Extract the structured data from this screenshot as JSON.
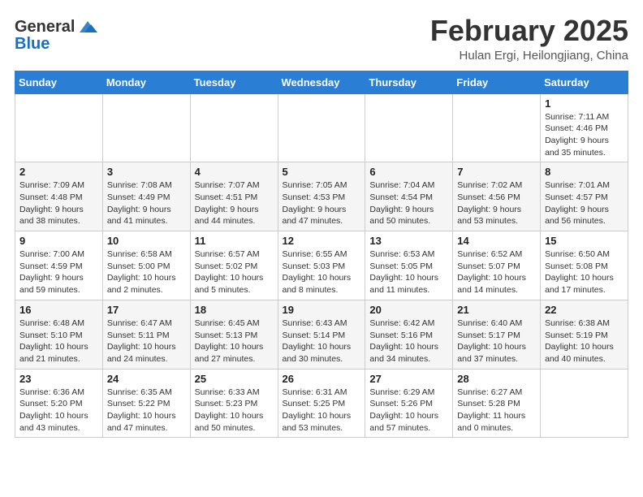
{
  "header": {
    "logo_general": "General",
    "logo_blue": "Blue",
    "month_title": "February 2025",
    "location": "Hulan Ergi, Heilongjiang, China"
  },
  "weekdays": [
    "Sunday",
    "Monday",
    "Tuesday",
    "Wednesday",
    "Thursday",
    "Friday",
    "Saturday"
  ],
  "weeks": [
    [
      {
        "day": "",
        "info": ""
      },
      {
        "day": "",
        "info": ""
      },
      {
        "day": "",
        "info": ""
      },
      {
        "day": "",
        "info": ""
      },
      {
        "day": "",
        "info": ""
      },
      {
        "day": "",
        "info": ""
      },
      {
        "day": "1",
        "info": "Sunrise: 7:11 AM\nSunset: 4:46 PM\nDaylight: 9 hours and 35 minutes."
      }
    ],
    [
      {
        "day": "2",
        "info": "Sunrise: 7:09 AM\nSunset: 4:48 PM\nDaylight: 9 hours and 38 minutes."
      },
      {
        "day": "3",
        "info": "Sunrise: 7:08 AM\nSunset: 4:49 PM\nDaylight: 9 hours and 41 minutes."
      },
      {
        "day": "4",
        "info": "Sunrise: 7:07 AM\nSunset: 4:51 PM\nDaylight: 9 hours and 44 minutes."
      },
      {
        "day": "5",
        "info": "Sunrise: 7:05 AM\nSunset: 4:53 PM\nDaylight: 9 hours and 47 minutes."
      },
      {
        "day": "6",
        "info": "Sunrise: 7:04 AM\nSunset: 4:54 PM\nDaylight: 9 hours and 50 minutes."
      },
      {
        "day": "7",
        "info": "Sunrise: 7:02 AM\nSunset: 4:56 PM\nDaylight: 9 hours and 53 minutes."
      },
      {
        "day": "8",
        "info": "Sunrise: 7:01 AM\nSunset: 4:57 PM\nDaylight: 9 hours and 56 minutes."
      }
    ],
    [
      {
        "day": "9",
        "info": "Sunrise: 7:00 AM\nSunset: 4:59 PM\nDaylight: 9 hours and 59 minutes."
      },
      {
        "day": "10",
        "info": "Sunrise: 6:58 AM\nSunset: 5:00 PM\nDaylight: 10 hours and 2 minutes."
      },
      {
        "day": "11",
        "info": "Sunrise: 6:57 AM\nSunset: 5:02 PM\nDaylight: 10 hours and 5 minutes."
      },
      {
        "day": "12",
        "info": "Sunrise: 6:55 AM\nSunset: 5:03 PM\nDaylight: 10 hours and 8 minutes."
      },
      {
        "day": "13",
        "info": "Sunrise: 6:53 AM\nSunset: 5:05 PM\nDaylight: 10 hours and 11 minutes."
      },
      {
        "day": "14",
        "info": "Sunrise: 6:52 AM\nSunset: 5:07 PM\nDaylight: 10 hours and 14 minutes."
      },
      {
        "day": "15",
        "info": "Sunrise: 6:50 AM\nSunset: 5:08 PM\nDaylight: 10 hours and 17 minutes."
      }
    ],
    [
      {
        "day": "16",
        "info": "Sunrise: 6:48 AM\nSunset: 5:10 PM\nDaylight: 10 hours and 21 minutes."
      },
      {
        "day": "17",
        "info": "Sunrise: 6:47 AM\nSunset: 5:11 PM\nDaylight: 10 hours and 24 minutes."
      },
      {
        "day": "18",
        "info": "Sunrise: 6:45 AM\nSunset: 5:13 PM\nDaylight: 10 hours and 27 minutes."
      },
      {
        "day": "19",
        "info": "Sunrise: 6:43 AM\nSunset: 5:14 PM\nDaylight: 10 hours and 30 minutes."
      },
      {
        "day": "20",
        "info": "Sunrise: 6:42 AM\nSunset: 5:16 PM\nDaylight: 10 hours and 34 minutes."
      },
      {
        "day": "21",
        "info": "Sunrise: 6:40 AM\nSunset: 5:17 PM\nDaylight: 10 hours and 37 minutes."
      },
      {
        "day": "22",
        "info": "Sunrise: 6:38 AM\nSunset: 5:19 PM\nDaylight: 10 hours and 40 minutes."
      }
    ],
    [
      {
        "day": "23",
        "info": "Sunrise: 6:36 AM\nSunset: 5:20 PM\nDaylight: 10 hours and 43 minutes."
      },
      {
        "day": "24",
        "info": "Sunrise: 6:35 AM\nSunset: 5:22 PM\nDaylight: 10 hours and 47 minutes."
      },
      {
        "day": "25",
        "info": "Sunrise: 6:33 AM\nSunset: 5:23 PM\nDaylight: 10 hours and 50 minutes."
      },
      {
        "day": "26",
        "info": "Sunrise: 6:31 AM\nSunset: 5:25 PM\nDaylight: 10 hours and 53 minutes."
      },
      {
        "day": "27",
        "info": "Sunrise: 6:29 AM\nSunset: 5:26 PM\nDaylight: 10 hours and 57 minutes."
      },
      {
        "day": "28",
        "info": "Sunrise: 6:27 AM\nSunset: 5:28 PM\nDaylight: 11 hours and 0 minutes."
      },
      {
        "day": "",
        "info": ""
      }
    ]
  ]
}
